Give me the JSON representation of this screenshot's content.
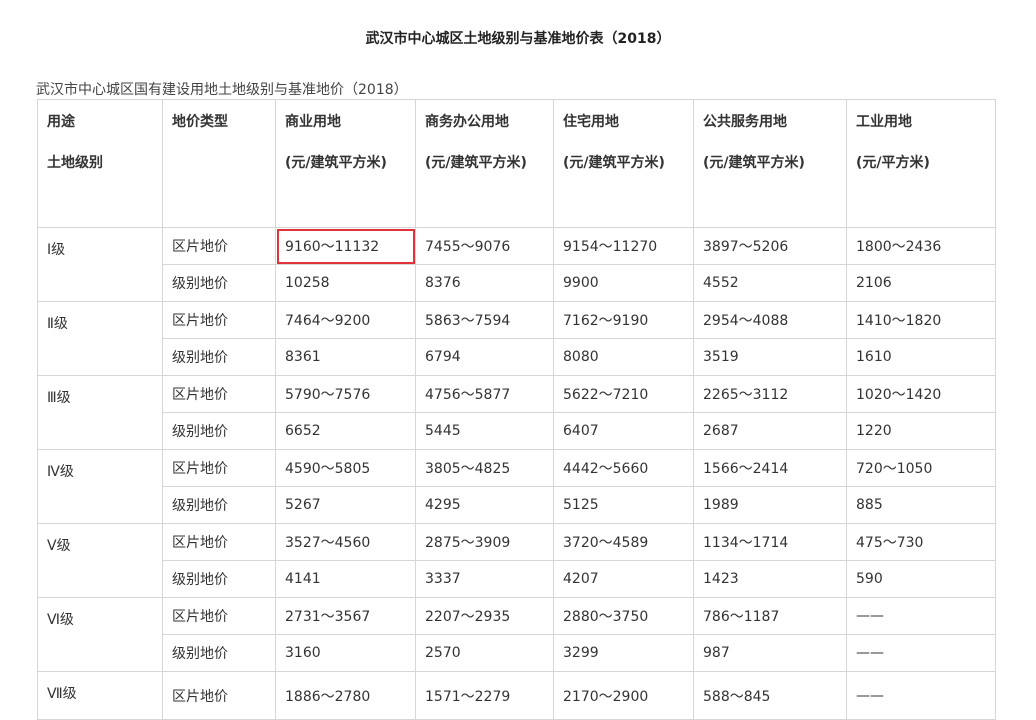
{
  "title": "武汉市中心城区土地级别与基准地价表（2018）",
  "caption": "武汉市中心城区国有建设用地土地级别与基准地价（2018）",
  "header": {
    "col1_line1": "用途",
    "col1_line2": "土地级别",
    "col2": "地价类型",
    "uses": [
      {
        "name": "商业用地",
        "unit": "(元/建筑平方米)"
      },
      {
        "name": "商务办公用地",
        "unit": "(元/建筑平方米)"
      },
      {
        "name": "住宅用地",
        "unit": "(元/建筑平方米)"
      },
      {
        "name": "公共服务用地",
        "unit": "(元/建筑平方米)"
      },
      {
        "name": "工业用地",
        "unit": "(元/平方米)"
      }
    ]
  },
  "levels": [
    {
      "name": "Ⅰ级",
      "area_label": "区片地价",
      "area": [
        "9160～11132",
        "7455～9076",
        "9154～11270",
        "3897～5206",
        "1800～2436"
      ],
      "grade_label": "级别地价",
      "grade": [
        "10258",
        "8376",
        "9900",
        "4552",
        "2106"
      ]
    },
    {
      "name": "Ⅱ级",
      "area_label": "区片地价",
      "area": [
        "7464～9200",
        "5863～7594",
        "7162～9190",
        "2954～4088",
        "1410～1820"
      ],
      "grade_label": "级别地价",
      "grade": [
        "8361",
        "6794",
        "8080",
        "3519",
        "1610"
      ]
    },
    {
      "name": "Ⅲ级",
      "area_label": "区片地价",
      "area": [
        "5790～7576",
        "4756～5877",
        "5622～7210",
        "2265～3112",
        "1020～1420"
      ],
      "grade_label": "级别地价",
      "grade": [
        "6652",
        "5445",
        "6407",
        "2687",
        "1220"
      ]
    },
    {
      "name": "Ⅳ级",
      "area_label": "区片地价",
      "area": [
        "4590～5805",
        "3805～4825",
        "4442～5660",
        "1566～2414",
        "720～1050"
      ],
      "grade_label": "级别地价",
      "grade": [
        "5267",
        "4295",
        "5125",
        "1989",
        "885"
      ]
    },
    {
      "name": "Ⅴ级",
      "area_label": "区片地价",
      "area": [
        "3527～4560",
        "2875～3909",
        "3720～4589",
        "1134～1714",
        "475～730"
      ],
      "grade_label": "级别地价",
      "grade": [
        "4141",
        "3337",
        "4207",
        "1423",
        "590"
      ]
    },
    {
      "name": "Ⅵ级",
      "area_label": "区片地价",
      "area": [
        "2731～3567",
        "2207～2935",
        "2880～3750",
        "786～1187",
        "——"
      ],
      "grade_label": "级别地价",
      "grade": [
        "3160",
        "2570",
        "3299",
        "987",
        "——"
      ]
    },
    {
      "name": "Ⅶ级",
      "area_label": "区片地价",
      "area": [
        "1886～2780",
        "1571～2279",
        "2170～2900",
        "588～845",
        "——"
      ]
    }
  ],
  "highlight_color": "#e0343a"
}
